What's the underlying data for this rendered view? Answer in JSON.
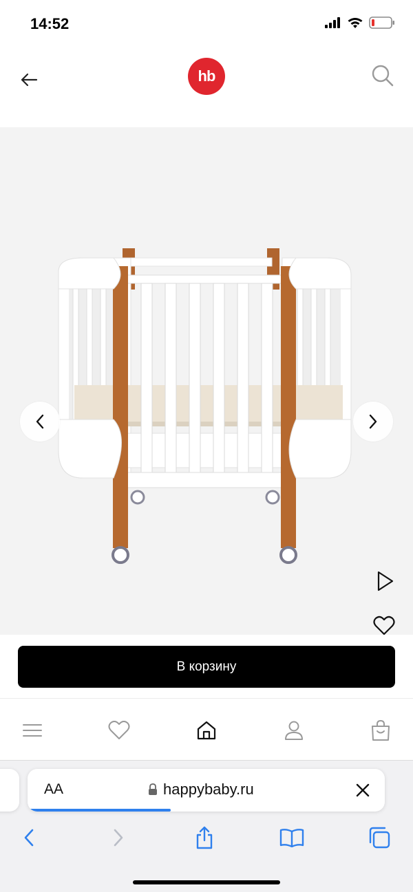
{
  "status": {
    "time": "14:52",
    "icons": [
      "signal-icon",
      "wifi-icon",
      "battery-low-icon"
    ],
    "battery_color": "#e5322d"
  },
  "header": {
    "logo_text": "hb",
    "logo_color": "#e0262e",
    "icons": [
      "back-arrow-icon",
      "search-icon"
    ]
  },
  "gallery": {
    "background": "#f3f3f3",
    "icons": [
      "chevron-left-icon",
      "chevron-right-icon",
      "play-icon",
      "heart-icon"
    ]
  },
  "cart": {
    "button_label": "В корзину",
    "button_color": "#000000"
  },
  "site_nav": {
    "items": [
      "menu-icon",
      "heart-icon",
      "home-icon",
      "user-icon",
      "bag-icon"
    ]
  },
  "safari": {
    "aa_label": "AA",
    "url": "happybaby.ru",
    "load_progress": 0.4,
    "accent": "#2f80ed",
    "toolbar": [
      "back-icon",
      "forward-icon",
      "share-icon",
      "bookmarks-icon",
      "tabs-icon"
    ]
  }
}
